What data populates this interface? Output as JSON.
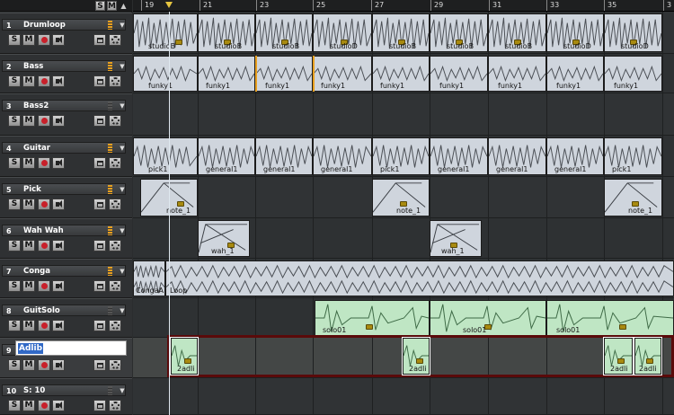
{
  "header": {
    "solo_label": "S",
    "mute_label": "M"
  },
  "bars": [
    "19",
    "21",
    "23",
    "25",
    "27",
    "29",
    "31",
    "33",
    "35",
    "3"
  ],
  "tracks": [
    {
      "num": "1",
      "name": "Drumloop",
      "solo": "S",
      "mute": "M"
    },
    {
      "num": "2",
      "name": "Bass",
      "solo": "S",
      "mute": "M"
    },
    {
      "num": "3",
      "name": "Bass2",
      "solo": "S",
      "mute": "M"
    },
    {
      "num": "4",
      "name": "Guitar",
      "solo": "S",
      "mute": "M"
    },
    {
      "num": "5",
      "name": "Pick",
      "solo": "S",
      "mute": "M"
    },
    {
      "num": "6",
      "name": "Wah Wah",
      "solo": "S",
      "mute": "M"
    },
    {
      "num": "7",
      "name": "Conga",
      "solo": "S",
      "mute": "M"
    },
    {
      "num": "8",
      "name": "GuitSolo",
      "solo": "S",
      "mute": "M"
    },
    {
      "num": "9",
      "name": "Adlib",
      "solo": "S",
      "mute": "M",
      "editing": true
    },
    {
      "num": "10",
      "name": "S: 10",
      "solo": "S",
      "mute": "M"
    }
  ],
  "clips": {
    "drumloop": [
      "studioB",
      "studioB",
      "studioB",
      "studioD",
      "studioB",
      "studioB",
      "studioB",
      "studioD"
    ],
    "bass": [
      "funky1",
      "funky1",
      "funky1",
      "funky1",
      "funky1",
      "funky1",
      "funky1",
      "funky1",
      "funky1"
    ],
    "guitar": [
      "pick1",
      "general1",
      "general1",
      "general1",
      "pick1",
      "general1",
      "general1",
      "general1",
      "pick1"
    ],
    "pick": [
      "note_1",
      "note_1",
      "note_1"
    ],
    "wahwah": [
      "wah_1",
      "wah_1"
    ],
    "conga": [
      "CongaA",
      "Loop"
    ],
    "guitsolo": [
      "solo01",
      "solo01",
      "solo01"
    ],
    "adlib": [
      "2adli",
      "2adli",
      "2adli",
      "2adli"
    ]
  },
  "colors": {
    "accent": "#e8a020",
    "selection": "#5a0a0a",
    "audio_clip": "#cfd5dd",
    "solo_clip": "#bfe6c4",
    "rename_highlight": "#3169c6"
  }
}
